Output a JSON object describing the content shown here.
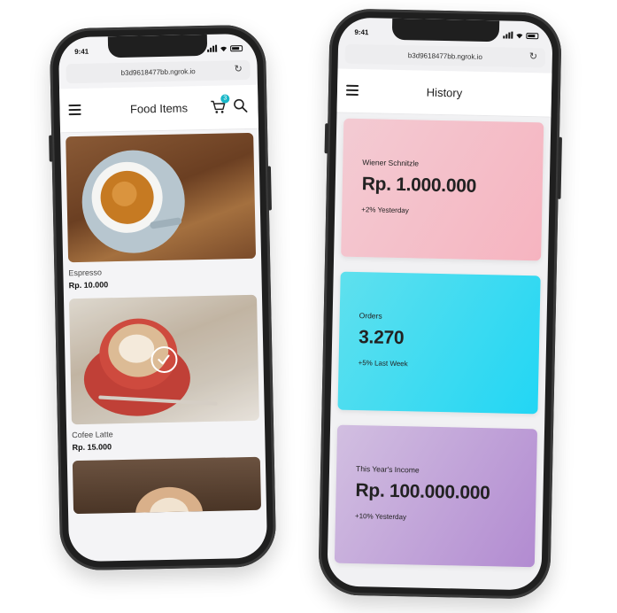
{
  "left_phone": {
    "status_time": "9:41",
    "url": "b3d9618477bb.ngrok.io",
    "app_title": "Food Items",
    "cart_count": "3",
    "items": [
      {
        "name": "Espresso",
        "price": "Rp. 10.000",
        "selected": false
      },
      {
        "name": "Cofee Latte",
        "price": "Rp. 15.000",
        "selected": true
      }
    ]
  },
  "right_phone": {
    "status_time": "9:41",
    "url": "b3d9618477bb.ngrok.io",
    "app_title": "History",
    "cards": [
      {
        "label": "Wiener Schnitzle",
        "value": "Rp. 1.000.000",
        "sub": "+2% Yesterday",
        "color": "#f6b4c0"
      },
      {
        "label": "Orders",
        "value": "3.270",
        "sub": "+5% Last Week",
        "color": "#22d6f4"
      },
      {
        "label": "This Year's Income",
        "value": "Rp. 100.000.000",
        "sub": "+10% Yesterday",
        "color": "#b28bd1"
      }
    ]
  },
  "icons": {
    "menu": "hamburger-icon",
    "cart": "cart-icon",
    "search": "search-icon",
    "reload": "reload-icon",
    "check": "check-icon"
  }
}
